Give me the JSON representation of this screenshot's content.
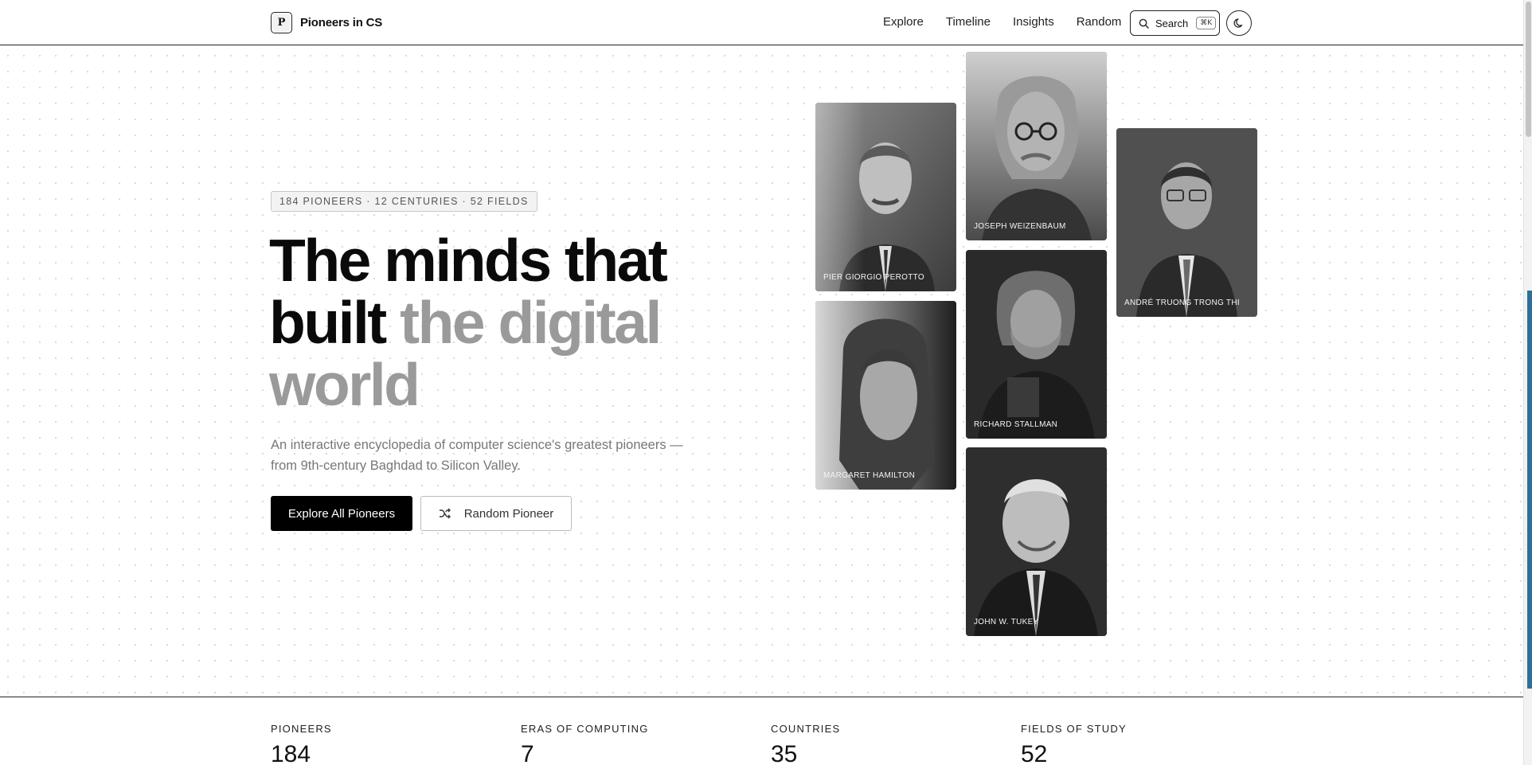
{
  "header": {
    "brand": {
      "logo_letter": "P",
      "name": "Pioneers in CS"
    },
    "nav": [
      "Explore",
      "Timeline",
      "Insights",
      "Random"
    ],
    "search": {
      "label": "Search",
      "shortcut": "⌘K",
      "icon": "search-icon"
    },
    "theme_toggle": {
      "icon": "moon-icon"
    }
  },
  "hero": {
    "badge": "184 PIONEERS · 12 CENTURIES · 52 FIELDS",
    "headline": {
      "line1": "The minds that",
      "line2_dark": "built",
      "line2_muted": "the digital",
      "line3_muted": "world"
    },
    "subtitle": "An interactive encyclopedia of computer science's greatest pioneers — from 9th-century Baghdad to Silicon Valley.",
    "primary_button": "Explore All Pioneers",
    "secondary_button": {
      "label": "Random Pioneer",
      "icon": "shuffle-icon"
    }
  },
  "portraits": [
    "PIER GIORGIO PEROTTO",
    "JOSEPH WEIZENBAUM",
    "ANDRÉ TRUONG TRONG THI",
    "MARGARET HAMILTON",
    "RICHARD STALLMAN",
    "JOHN W. TUKEY"
  ],
  "stats": [
    {
      "label": "PIONEERS",
      "value": "184"
    },
    {
      "label": "ERAS OF COMPUTING",
      "value": "7"
    },
    {
      "label": "COUNTRIES",
      "value": "35"
    },
    {
      "label": "FIELDS OF STUDY",
      "value": "52"
    }
  ],
  "colors": {
    "accent": "#000000",
    "muted_text": "#9a9a9a"
  }
}
